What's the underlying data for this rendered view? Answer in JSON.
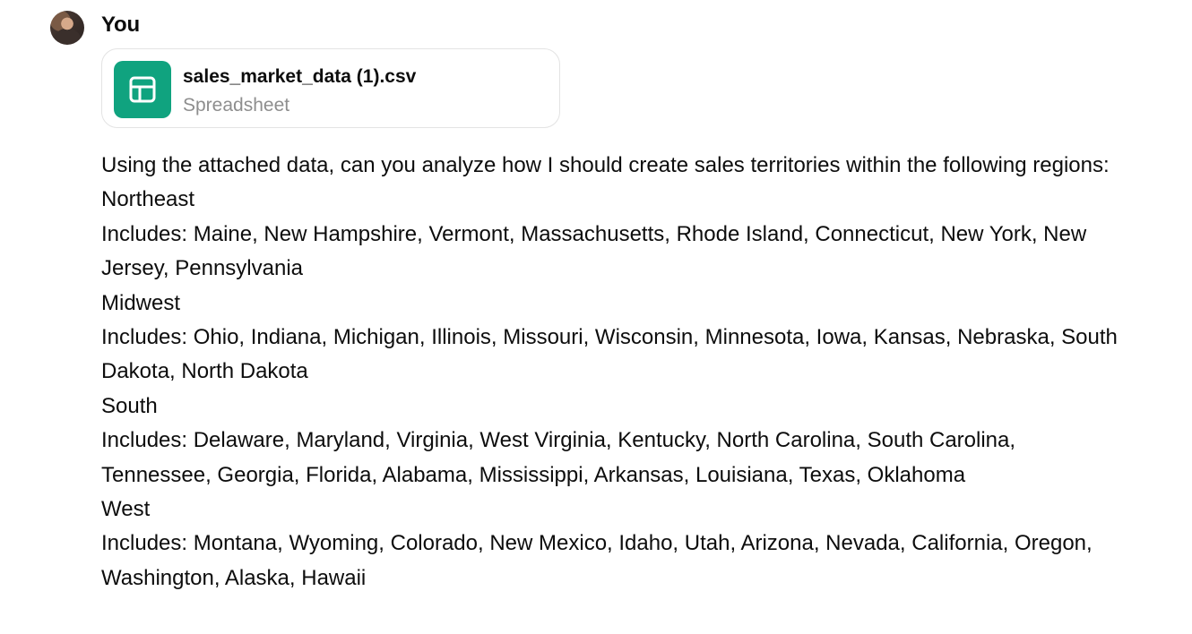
{
  "message": {
    "author": "You",
    "avatar_icon": "user-avatar",
    "attachment": {
      "name": "sales_market_data (1).csv",
      "type": "Spreadsheet",
      "icon": "spreadsheet-icon",
      "icon_color": "#10a37f"
    },
    "lines": [
      "Using the attached data, can you analyze how I should create sales territories within the following regions:",
      "Northeast",
      "Includes: Maine, New Hampshire, Vermont, Massachusetts, Rhode Island, Connecticut, New York, New Jersey, Pennsylvania",
      "Midwest",
      "Includes: Ohio, Indiana, Michigan, Illinois, Missouri, Wisconsin, Minnesota, Iowa, Kansas, Nebraska, South Dakota, North Dakota",
      "South",
      "Includes: Delaware, Maryland, Virginia, West Virginia, Kentucky, North Carolina, South Carolina, Tennessee, Georgia, Florida, Alabama, Mississippi, Arkansas, Louisiana, Texas, Oklahoma",
      "West",
      "Includes: Montana, Wyoming, Colorado, New Mexico, Idaho, Utah, Arizona, Nevada, California, Oregon, Washington, Alaska, Hawaii"
    ]
  }
}
